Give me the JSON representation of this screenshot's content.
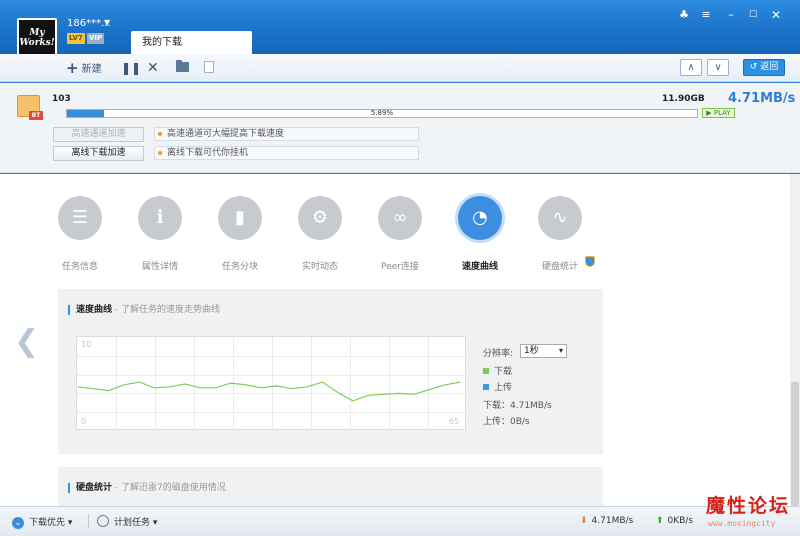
{
  "user": {
    "avatar_text": "My Works!",
    "name": "186***...",
    "level": "LV7",
    "vip": "VIP"
  },
  "tabs": {
    "downloads": "我的下载"
  },
  "toolbar": {
    "new": "新建",
    "back": "返回"
  },
  "task": {
    "name": "103",
    "size": "11.90GB",
    "speed": "4.71MB/s",
    "progress": 5.89,
    "progress_text": "5.89%",
    "play": "PLAY",
    "tag": "BT"
  },
  "accel": {
    "highspeed": "高速通道加速",
    "offline": "离线下载加速",
    "hint_highspeed": "高速通道可大幅提高下载速度",
    "hint_offline": "离线下载可代你挂机"
  },
  "detail_tabs": [
    {
      "label": "任务信息",
      "icon": "list-icon"
    },
    {
      "label": "属性详情",
      "icon": "info-icon"
    },
    {
      "label": "任务分块",
      "icon": "bars-icon"
    },
    {
      "label": "实时动态",
      "icon": "gear-icon"
    },
    {
      "label": "Peer连接",
      "icon": "link-icon"
    },
    {
      "label": "速度曲线",
      "icon": "speedometer-icon"
    },
    {
      "label": "硬盘统计",
      "icon": "wave-icon"
    }
  ],
  "speed_section": {
    "title": "速度曲线",
    "subtitle": " - 了解任务的速度走势曲线",
    "res_label": "分辨率:",
    "res_value": "1秒",
    "legend_down": "下载",
    "legend_up": "上传",
    "down_readout": "下载：4.71MB/s",
    "up_readout": "上传：0B/s"
  },
  "disk_section": {
    "title": "硬盘统计",
    "subtitle": " - 了解迅雷7的磁盘使用情况"
  },
  "chart_data": {
    "type": "line",
    "ylim": [
      0,
      10
    ],
    "y_top_label": "10",
    "y_bottom_label": "0",
    "x_end_label": "65",
    "series": [
      {
        "name": "下载",
        "color": "#7ecb5a",
        "values": [
          4.7,
          4.5,
          4.3,
          4.9,
          5.2,
          4.6,
          4.7,
          5.0,
          4.6,
          4.6,
          5.1,
          4.9,
          4.6,
          4.8,
          4.5,
          4.7,
          5.2,
          4.1,
          3.2,
          3.8,
          3.9,
          4.0,
          3.9,
          4.4,
          4.9,
          5.2
        ]
      },
      {
        "name": "上传",
        "color": "#3a9be0",
        "values": [
          0
        ]
      }
    ]
  },
  "status": {
    "priority": "下载优先",
    "schedule": "计划任务",
    "down": "4.71MB/s",
    "up": "0KB/s"
  },
  "watermark": {
    "text": "魔性论坛",
    "url": "www.moxingcity"
  }
}
